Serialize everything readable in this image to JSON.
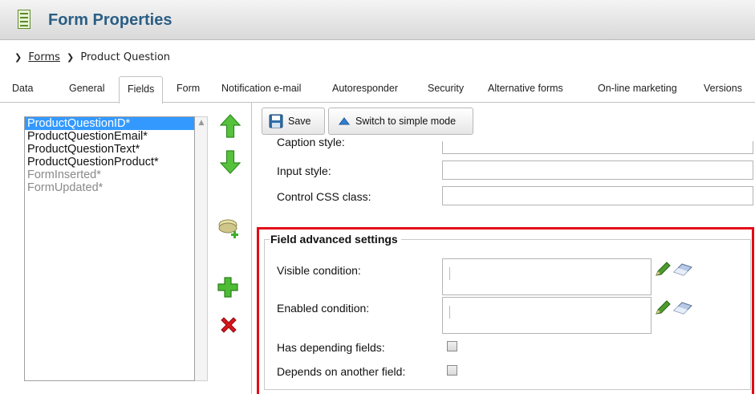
{
  "header": {
    "title": "Form Properties",
    "icon": "form-document-icon"
  },
  "breadcrumb": {
    "root": "Forms",
    "current": "Product Question"
  },
  "tabs": [
    {
      "label": "Data"
    },
    {
      "label": "General"
    },
    {
      "label": "Fields",
      "active": true
    },
    {
      "label": "Form"
    },
    {
      "label": "Notification e-mail"
    },
    {
      "label": "Autoresponder"
    },
    {
      "label": "Security"
    },
    {
      "label": "Alternative forms"
    },
    {
      "label": "On-line marketing"
    },
    {
      "label": "Versions"
    }
  ],
  "field_list": {
    "items": [
      {
        "label": "ProductQuestionID*",
        "selected": true
      },
      {
        "label": "ProductQuestionEmail*"
      },
      {
        "label": "ProductQuestionText*"
      },
      {
        "label": "ProductQuestionProduct*"
      },
      {
        "label": "FormInserted*",
        "system": true
      },
      {
        "label": "FormUpdated*",
        "system": true
      }
    ]
  },
  "tools": {
    "move_up": "arrow-up-icon",
    "move_down": "arrow-down-icon",
    "new_category": "new-category-icon",
    "add_field": "add-icon",
    "delete_field": "delete-icon"
  },
  "toolbar": {
    "save_label": "Save",
    "switch_label": "Switch to simple mode"
  },
  "styles": {
    "caption_style_label": "Caption style:",
    "input_style_label": "Input style:",
    "control_css_label": "Control CSS class:"
  },
  "advanced": {
    "legend": "Field advanced settings",
    "visible_condition_label": "Visible condition:",
    "enabled_condition_label": "Enabled condition:",
    "has_depending_label": "Has depending fields:",
    "depends_on_label": "Depends on another field:",
    "has_depending_checked": false,
    "depends_on_checked": false
  },
  "colors": {
    "title": "#2a5e84",
    "highlight": "#e30b17",
    "selection": "#3399ff",
    "arrow_green": "#3fae29",
    "delete_red": "#d8151b"
  }
}
